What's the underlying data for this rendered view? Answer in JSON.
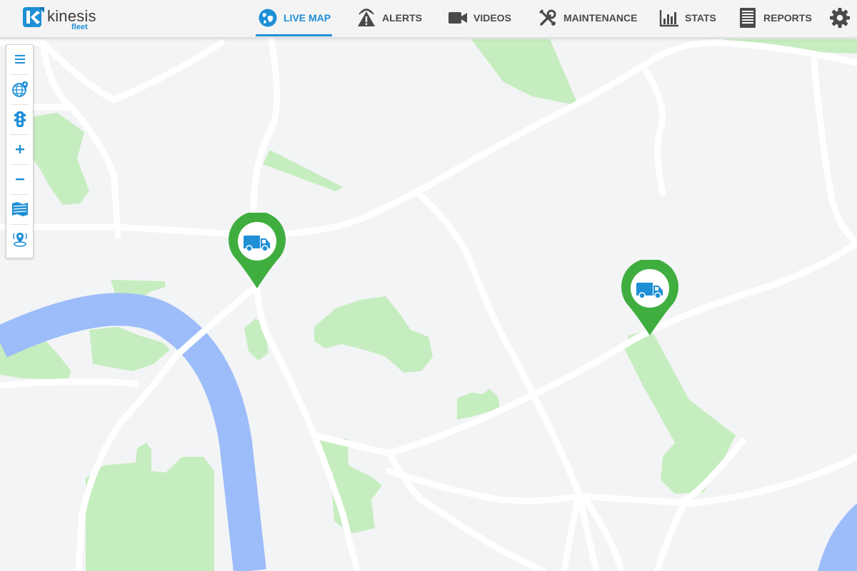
{
  "app": {
    "brand": "kinesis",
    "brand_sub": "fleet"
  },
  "nav": {
    "items": [
      {
        "label": "LIVE MAP",
        "icon": "globe-icon",
        "active": true
      },
      {
        "label": "ALERTS",
        "icon": "alert-triangle-icon",
        "active": false
      },
      {
        "label": "VIDEOS",
        "icon": "video-camera-icon",
        "active": false
      },
      {
        "label": "MAINTENANCE",
        "icon": "wrench-screwdriver-icon",
        "active": false
      },
      {
        "label": "STATS",
        "icon": "bar-chart-icon",
        "active": false
      },
      {
        "label": "REPORTS",
        "icon": "report-document-icon",
        "active": false
      }
    ],
    "settings_icon": "gear-icon"
  },
  "map_tools": [
    {
      "name": "menu",
      "icon": "hamburger-menu-icon"
    },
    {
      "name": "map-layers",
      "icon": "globe-pin-icon"
    },
    {
      "name": "traffic",
      "icon": "traffic-light-icon"
    },
    {
      "name": "zoom-in",
      "icon": "plus-icon"
    },
    {
      "name": "zoom-out",
      "icon": "minus-icon"
    },
    {
      "name": "map-type",
      "icon": "map-icon"
    },
    {
      "name": "geofence",
      "icon": "location-signal-icon"
    }
  ],
  "vehicles": [
    {
      "name": "vehicle-1",
      "type": "van",
      "icon": "van-icon",
      "status_color": "#3fae3f"
    },
    {
      "name": "vehicle-2",
      "type": "van",
      "icon": "van-icon",
      "status_color": "#3fae3f"
    }
  ],
  "colors": {
    "accent": "#1f8fd6",
    "nav_text": "#4a4a4a",
    "topbar_bg": "#f4f4f4",
    "map_bg": "#f3f4f6",
    "road": "#ffffff",
    "park": "#c6edbf",
    "water": "#9dbdfa",
    "marker_green": "#3fae3f",
    "van_blue": "#1f8fd6"
  }
}
